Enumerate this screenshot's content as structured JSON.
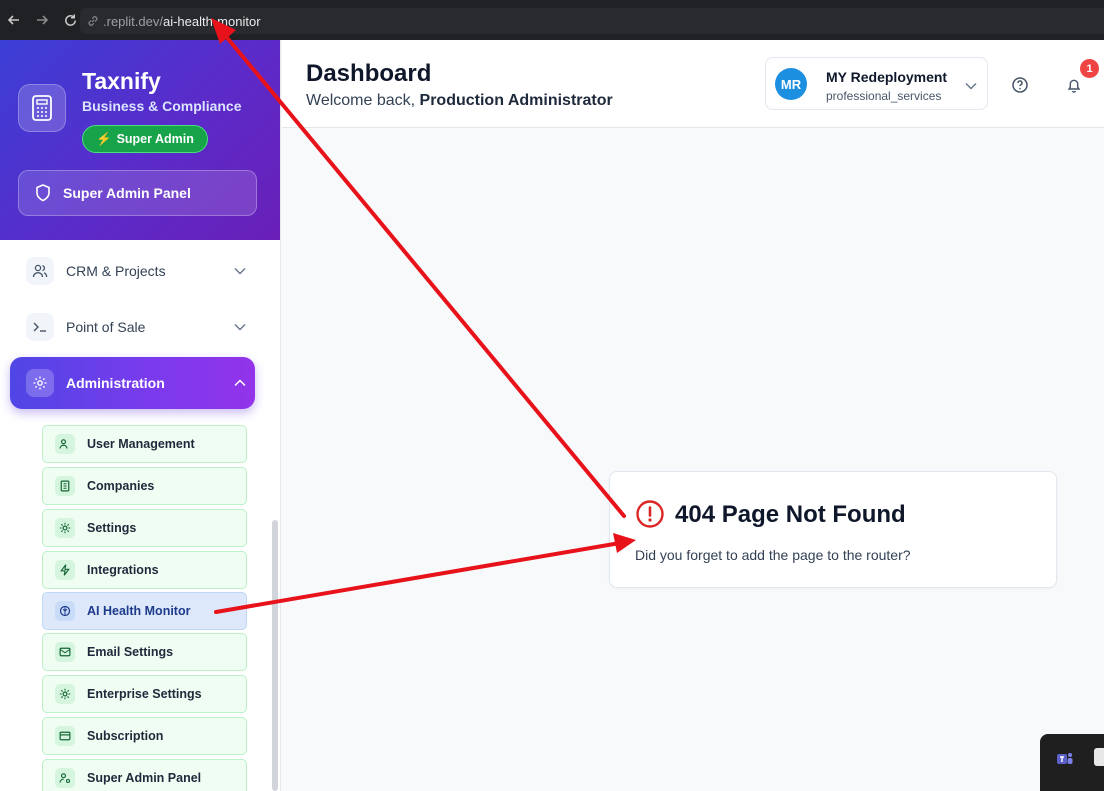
{
  "browser": {
    "url_host": ".replit.dev/",
    "url_path": "ai-health-monitor"
  },
  "brand": {
    "name": "Taxnify",
    "subtitle": "Business & Compliance",
    "role_badge": "Super Admin",
    "panel_button": "Super Admin Panel"
  },
  "sidebar": {
    "items": [
      {
        "label": "CRM & Projects",
        "icon": "users-icon",
        "expanded": false
      },
      {
        "label": "Point of Sale",
        "icon": "terminal-icon",
        "expanded": false
      },
      {
        "label": "Administration",
        "icon": "gear-icon",
        "expanded": true
      }
    ],
    "admin_items": [
      {
        "label": "User Management",
        "icon": "users-icon"
      },
      {
        "label": "Companies",
        "icon": "building-icon"
      },
      {
        "label": "Settings",
        "icon": "gear-icon"
      },
      {
        "label": "Integrations",
        "icon": "zap-icon"
      },
      {
        "label": "AI Health Monitor",
        "icon": "brain-icon",
        "current": true
      },
      {
        "label": "Email Settings",
        "icon": "mail-icon"
      },
      {
        "label": "Enterprise Settings",
        "icon": "gear-icon"
      },
      {
        "label": "Subscription",
        "icon": "credit-card-icon"
      },
      {
        "label": "Super Admin Panel",
        "icon": "user-cog-icon"
      }
    ]
  },
  "header": {
    "title": "Dashboard",
    "welcome_prefix": "Welcome back, ",
    "welcome_name": "Production Administrator",
    "company": {
      "initials": "MR",
      "name": "MY Redeployment",
      "type": "professional_services"
    },
    "notification_count": "1"
  },
  "error_card": {
    "title": "404 Page Not Found",
    "message": "Did you forget to add the page to the router?"
  },
  "colors": {
    "accent": "#4f46e5",
    "error": "#dc2626",
    "annotation_arrow": "#e8121b",
    "success": "#16a34a"
  }
}
